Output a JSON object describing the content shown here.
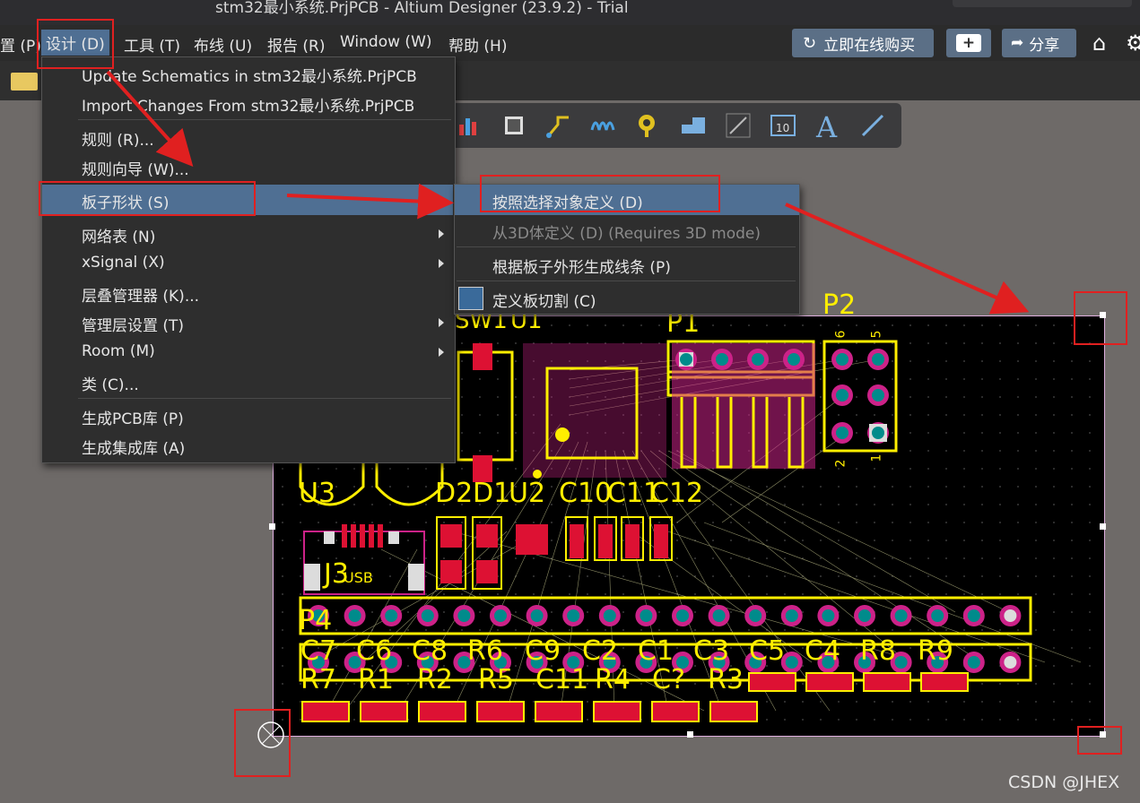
{
  "window": {
    "title": "stm32最小系统.PrjPCB - Altium Designer (23.9.2) - Trial"
  },
  "menubar": {
    "items": [
      "置 (P)",
      "设计 (D)",
      "工具 (T)",
      "布线 (U)",
      "报告 (R)",
      "Window (W)",
      "帮助 (H)"
    ],
    "buy_label": "立即在线购买",
    "share_label": "分享"
  },
  "doc_tab": {
    "label": "*"
  },
  "design_menu": {
    "items": [
      "Update Schematics in stm32最小系统.PrjPCB",
      "Import Changes From stm32最小系统.PrjPCB",
      "规则 (R)...",
      "规则向导 (W)...",
      "板子形状 (S)",
      "网络表 (N)",
      "xSignal (X)",
      "层叠管理器 (K)...",
      "管理层设置 (T)",
      "Room (M)",
      "类 (C)...",
      "生成PCB库 (P)",
      "生成集成库 (A)"
    ]
  },
  "board_shape_submenu": {
    "items": [
      "按照选择对象定义 (D)",
      "从3D体定义 (D) (Requires 3D mode)",
      "根据板子外形生成线条 (P)",
      "定义板切割 (C)"
    ]
  },
  "pcb": {
    "designators": [
      "P2",
      "P1",
      "SW1",
      "U1",
      "U3",
      "D2",
      "D1",
      "U2",
      "C10",
      "C11",
      "C12",
      "J3",
      "USB",
      "P4",
      "C7",
      "C6",
      "C8",
      "R6",
      "C9",
      "C2",
      "C1",
      "C3",
      "C5",
      "C4",
      "R8",
      "R9",
      "R7",
      "R1",
      "R2",
      "R5",
      "C11",
      "R4",
      "C?",
      "R3"
    ],
    "header_pins": [
      "6",
      "5",
      "2",
      "1"
    ]
  },
  "watermark": "CSDN @JHEX",
  "colors": {
    "highlight": "#4f6f93",
    "annotation_red": "#e02020",
    "silk": "#ffee00",
    "pad": "#008b8b",
    "board": "#000000"
  }
}
